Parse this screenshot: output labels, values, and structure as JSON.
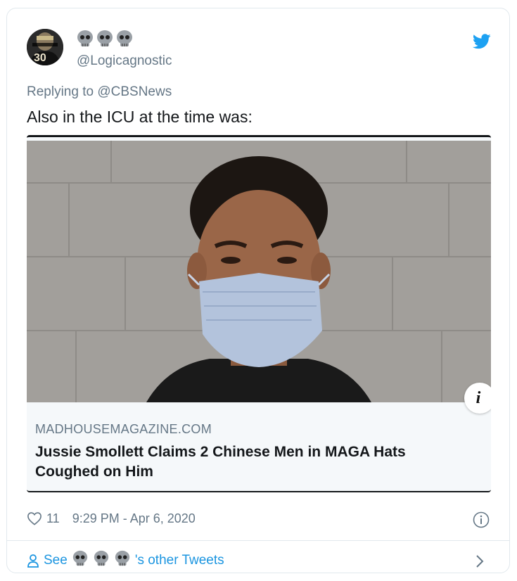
{
  "tweet": {
    "display_name_icons": [
      "skull-icon",
      "skull-icon",
      "skull-icon"
    ],
    "handle": "@Logicagnostic",
    "replying_to": "Replying to @CBSNews",
    "text": "Also in the ICU at the time was:",
    "likes": "11",
    "timestamp": "9:29 PM - Apr 6, 2020"
  },
  "link_card": {
    "domain": "MADHOUSEMAGAZINE.COM",
    "headline": "Jussie Smollett Claims 2 Chinese Men in MAGA Hats Coughed on Him",
    "info_badge": "i"
  },
  "footer": {
    "see_label": "See",
    "other_tweets_label": "'s other Tweets"
  },
  "colors": {
    "accent": "#1da1f2",
    "link": "#1b95e0",
    "muted": "#657786",
    "border": "#e1e8ed"
  }
}
